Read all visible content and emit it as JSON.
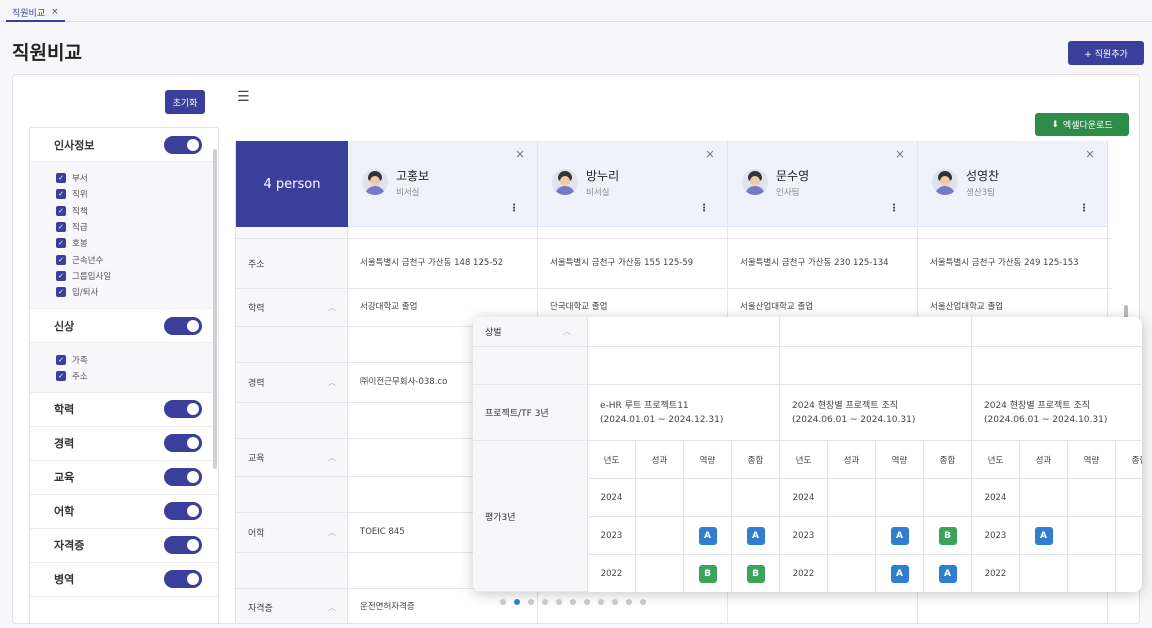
{
  "tab": {
    "label": "직원비교",
    "close": "×"
  },
  "page": {
    "title": "직원비교",
    "add_button": "+ 직원추가"
  },
  "filter": {
    "reset_label": "초기화",
    "sections": [
      {
        "title": "인사정보",
        "items": [
          "부서",
          "직위",
          "직책",
          "직급",
          "호봉",
          "근속년수",
          "그룹입사일",
          "입/퇴사"
        ]
      },
      {
        "title": "신상",
        "items": [
          "가족",
          "주소"
        ]
      },
      {
        "title": "학력",
        "items": []
      },
      {
        "title": "경력",
        "items": []
      },
      {
        "title": "교육",
        "items": []
      },
      {
        "title": "어학",
        "items": []
      },
      {
        "title": "자격증",
        "items": []
      },
      {
        "title": "병역",
        "items": []
      }
    ]
  },
  "toolbar": {
    "excel_label": "엑셀다운로드"
  },
  "grid": {
    "count_label": "4 person",
    "employees": [
      {
        "name": "고홍보",
        "dept": "비서실"
      },
      {
        "name": "방누리",
        "dept": "비서실"
      },
      {
        "name": "문수영",
        "dept": "인사팀"
      },
      {
        "name": "성영찬",
        "dept": "생산3팀"
      }
    ],
    "rows": [
      {
        "label": "주소",
        "values": [
          "서울특별시 금천구 가산동 148 125-52",
          "서울특별시 금천구 가산동 155 125-59",
          "서울특별시 금천구 가산동 230 125-134",
          "서울특별시 금천구 가산동 249 125-153"
        ]
      },
      {
        "label": "학력",
        "values": [
          "서강대학교 졸업",
          "단국대학교 졸업",
          "서울산업대학교 졸업",
          "서울산업대학교 졸업"
        ]
      },
      {
        "label": "경력",
        "values": [
          "㈜이전근무회사-038.co",
          "",
          "",
          ""
        ]
      },
      {
        "label": "교육",
        "values": [
          "",
          "",
          "",
          ""
        ]
      },
      {
        "label": "어학",
        "values": [
          "TOEIC 845",
          "",
          "",
          ""
        ]
      },
      {
        "label": "자격증",
        "values": [
          "운전면허자격증",
          "",
          "",
          ""
        ]
      }
    ]
  },
  "popup": {
    "award_label": "상벌",
    "project_label": "프로젝트/TF 3년",
    "eval_label": "평가3년",
    "projects": [
      {
        "name": "e-HR 루트 프로젝트11",
        "period": "(2024.01.01 ~ 2024.12.31)"
      },
      {
        "name": "2024 현장별 프로젝트 조직",
        "period": "(2024.06.01 ~ 2024.10.31)"
      },
      {
        "name": "2024 현장별 프로젝트 조직",
        "period": "(2024.06.01 ~ 2024.10.31)"
      }
    ],
    "eval_headers": [
      "년도",
      "성과",
      "역량",
      "종합"
    ],
    "eval_groups": [
      {
        "rows": [
          {
            "year": "2024",
            "perf": "",
            "comp": "",
            "total": ""
          },
          {
            "year": "2023",
            "perf": "",
            "comp": "A",
            "total": "A"
          },
          {
            "year": "2022",
            "perf": "",
            "comp": "B",
            "total": "B"
          }
        ]
      },
      {
        "rows": [
          {
            "year": "2024",
            "perf": "",
            "comp": "",
            "total": ""
          },
          {
            "year": "2023",
            "perf": "",
            "comp": "A",
            "total": "B"
          },
          {
            "year": "2022",
            "perf": "",
            "comp": "A",
            "total": "A"
          }
        ]
      },
      {
        "rows": [
          {
            "year": "2024",
            "perf": "",
            "comp": "",
            "total": ""
          },
          {
            "year": "2023",
            "perf": "A",
            "comp": "",
            "total": ""
          },
          {
            "year": "2022",
            "perf": "",
            "comp": "",
            "total": ""
          }
        ]
      }
    ],
    "badge_colors": {
      "A": "#2f7fd1",
      "B": "#3aa55a"
    }
  },
  "pagination": {
    "count": 11,
    "active": 1
  }
}
